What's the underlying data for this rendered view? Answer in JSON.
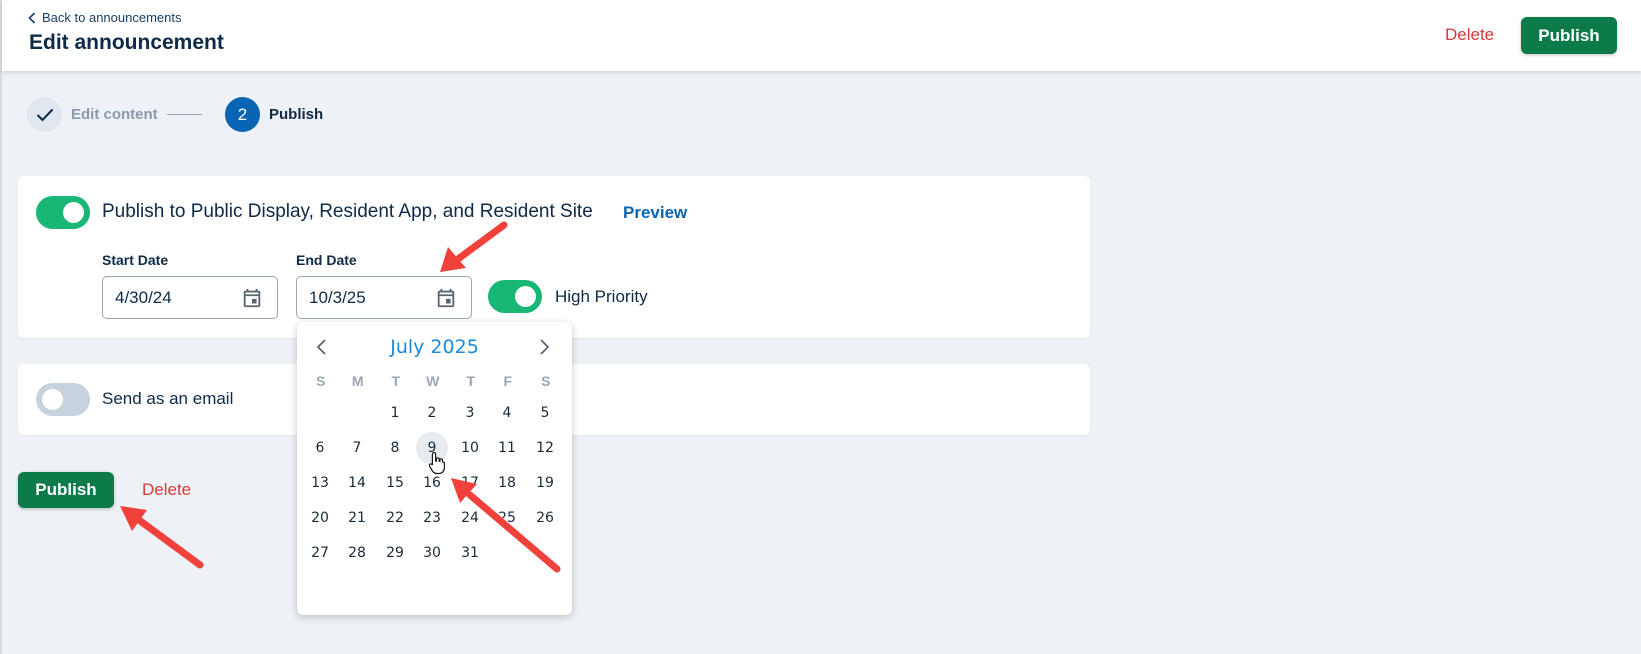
{
  "header": {
    "back_label": "Back to announcements",
    "title": "Edit announcement",
    "delete_label": "Delete",
    "publish_label": "Publish"
  },
  "stepper": {
    "step1_label": "Edit content",
    "step2_number": "2",
    "step2_label": "Publish"
  },
  "publish_card": {
    "toggle_on": true,
    "label": "Publish to Public Display, Resident App, and Resident Site",
    "preview_label": "Preview",
    "start_date_label": "Start Date",
    "start_date_value": "4/30/24",
    "end_date_label": "End Date",
    "end_date_value": "10/3/25",
    "high_priority_on": true,
    "high_priority_label": "High Priority"
  },
  "email_card": {
    "toggle_on": false,
    "label": "Send as an email"
  },
  "footer": {
    "publish_label": "Publish",
    "delete_label": "Delete"
  },
  "date_picker": {
    "month_label": "July 2025",
    "weekdays": [
      "S",
      "M",
      "T",
      "W",
      "T",
      "F",
      "S"
    ],
    "hovered_day": "9",
    "weeks": [
      [
        "",
        "",
        "1",
        "2",
        "3",
        "4",
        "5"
      ],
      [
        "6",
        "7",
        "8",
        "9",
        "10",
        "11",
        "12"
      ],
      [
        "13",
        "14",
        "15",
        "16",
        "17",
        "18",
        "19"
      ],
      [
        "20",
        "21",
        "22",
        "23",
        "24",
        "25",
        "26"
      ],
      [
        "27",
        "28",
        "29",
        "30",
        "31",
        "",
        ""
      ]
    ]
  },
  "colors": {
    "primary_green": "#0d7a4a",
    "toggle_green": "#19b774",
    "delete_red": "#dc3a3a",
    "link_blue": "#0a64b4",
    "month_blue": "#1a8ae0",
    "arrow_red": "#f0423a"
  },
  "icons": {
    "back": "chevron-left-icon",
    "step_done": "check-icon",
    "calendar": "calendar-icon",
    "prev_month": "chevron-left-icon",
    "next_month": "chevron-right-icon",
    "cursor": "hand-pointer-icon"
  }
}
